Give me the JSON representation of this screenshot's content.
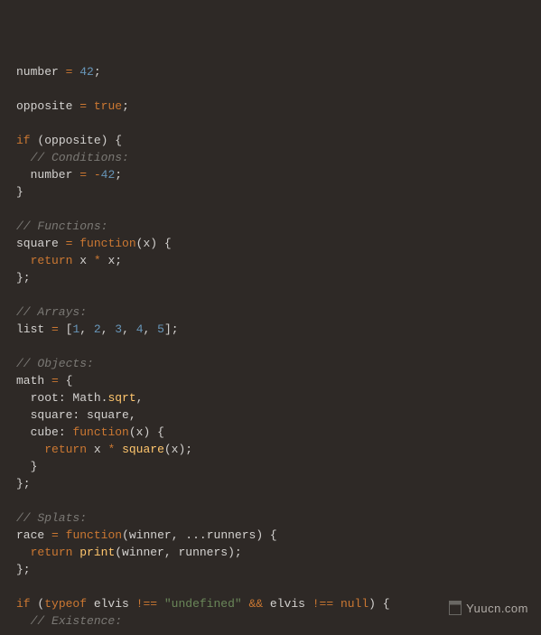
{
  "watermark": "Yuucn.com",
  "code": {
    "lines": [
      [
        {
          "t": "number",
          "c": "id"
        },
        {
          "t": " ",
          "c": "ws"
        },
        {
          "t": "=",
          "c": "op"
        },
        {
          "t": " ",
          "c": "ws"
        },
        {
          "t": "42",
          "c": "num"
        },
        {
          "t": ";",
          "c": "pn"
        }
      ],
      [],
      [
        {
          "t": "opposite",
          "c": "id"
        },
        {
          "t": " ",
          "c": "ws"
        },
        {
          "t": "=",
          "c": "op"
        },
        {
          "t": " ",
          "c": "ws"
        },
        {
          "t": "true",
          "c": "kw"
        },
        {
          "t": ";",
          "c": "pn"
        }
      ],
      [],
      [
        {
          "t": "if",
          "c": "kw"
        },
        {
          "t": " (opposite) {",
          "c": "pn"
        }
      ],
      [
        {
          "t": "  ",
          "c": "ws"
        },
        {
          "t": "// Conditions:",
          "c": "cm"
        }
      ],
      [
        {
          "t": "  number ",
          "c": "id"
        },
        {
          "t": "=",
          "c": "op"
        },
        {
          "t": " ",
          "c": "ws"
        },
        {
          "t": "-",
          "c": "op"
        },
        {
          "t": "42",
          "c": "num"
        },
        {
          "t": ";",
          "c": "pn"
        }
      ],
      [
        {
          "t": "}",
          "c": "pn"
        }
      ],
      [],
      [
        {
          "t": "// Functions:",
          "c": "cm"
        }
      ],
      [
        {
          "t": "square",
          "c": "id"
        },
        {
          "t": " ",
          "c": "ws"
        },
        {
          "t": "=",
          "c": "op"
        },
        {
          "t": " ",
          "c": "ws"
        },
        {
          "t": "function",
          "c": "kw"
        },
        {
          "t": "(",
          "c": "pn"
        },
        {
          "t": "x",
          "c": "id"
        },
        {
          "t": ") {",
          "c": "pn"
        }
      ],
      [
        {
          "t": "  ",
          "c": "ws"
        },
        {
          "t": "return",
          "c": "kw"
        },
        {
          "t": " x ",
          "c": "id"
        },
        {
          "t": "*",
          "c": "op"
        },
        {
          "t": " x;",
          "c": "id"
        }
      ],
      [
        {
          "t": "};",
          "c": "pn"
        }
      ],
      [],
      [
        {
          "t": "// Arrays:",
          "c": "cm"
        }
      ],
      [
        {
          "t": "list",
          "c": "id"
        },
        {
          "t": " ",
          "c": "ws"
        },
        {
          "t": "=",
          "c": "op"
        },
        {
          "t": " [",
          "c": "pn"
        },
        {
          "t": "1",
          "c": "num"
        },
        {
          "t": ", ",
          "c": "pn"
        },
        {
          "t": "2",
          "c": "num"
        },
        {
          "t": ", ",
          "c": "pn"
        },
        {
          "t": "3",
          "c": "num"
        },
        {
          "t": ", ",
          "c": "pn"
        },
        {
          "t": "4",
          "c": "num"
        },
        {
          "t": ", ",
          "c": "pn"
        },
        {
          "t": "5",
          "c": "num"
        },
        {
          "t": "];",
          "c": "pn"
        }
      ],
      [],
      [
        {
          "t": "// Objects:",
          "c": "cm"
        }
      ],
      [
        {
          "t": "math",
          "c": "id"
        },
        {
          "t": " ",
          "c": "ws"
        },
        {
          "t": "=",
          "c": "op"
        },
        {
          "t": " {",
          "c": "pn"
        }
      ],
      [
        {
          "t": "  ",
          "c": "ws"
        },
        {
          "t": "root",
          "c": "id"
        },
        {
          "t": ": Math.",
          "c": "pn"
        },
        {
          "t": "sqrt",
          "c": "fn"
        },
        {
          "t": ",",
          "c": "pn"
        }
      ],
      [
        {
          "t": "  ",
          "c": "ws"
        },
        {
          "t": "square",
          "c": "id"
        },
        {
          "t": ": square,",
          "c": "pn"
        }
      ],
      [
        {
          "t": "  ",
          "c": "ws"
        },
        {
          "t": "cube",
          "c": "id"
        },
        {
          "t": ": ",
          "c": "pn"
        },
        {
          "t": "function",
          "c": "kw"
        },
        {
          "t": "(",
          "c": "pn"
        },
        {
          "t": "x",
          "c": "id"
        },
        {
          "t": ") {",
          "c": "pn"
        }
      ],
      [
        {
          "t": "    ",
          "c": "ws"
        },
        {
          "t": "return",
          "c": "kw"
        },
        {
          "t": " x ",
          "c": "id"
        },
        {
          "t": "*",
          "c": "op"
        },
        {
          "t": " ",
          "c": "ws"
        },
        {
          "t": "square",
          "c": "fn"
        },
        {
          "t": "(x);",
          "c": "pn"
        }
      ],
      [
        {
          "t": "  }",
          "c": "pn"
        }
      ],
      [
        {
          "t": "};",
          "c": "pn"
        }
      ],
      [],
      [
        {
          "t": "// Splats:",
          "c": "cm"
        }
      ],
      [
        {
          "t": "race",
          "c": "id"
        },
        {
          "t": " ",
          "c": "ws"
        },
        {
          "t": "=",
          "c": "op"
        },
        {
          "t": " ",
          "c": "ws"
        },
        {
          "t": "function",
          "c": "kw"
        },
        {
          "t": "(",
          "c": "pn"
        },
        {
          "t": "winner",
          "c": "id"
        },
        {
          "t": ", ...",
          "c": "pn"
        },
        {
          "t": "runners",
          "c": "id"
        },
        {
          "t": ") {",
          "c": "pn"
        }
      ],
      [
        {
          "t": "  ",
          "c": "ws"
        },
        {
          "t": "return",
          "c": "kw"
        },
        {
          "t": " ",
          "c": "ws"
        },
        {
          "t": "print",
          "c": "fn"
        },
        {
          "t": "(winner, runners);",
          "c": "pn"
        }
      ],
      [
        {
          "t": "};",
          "c": "pn"
        }
      ],
      [],
      [
        {
          "t": "if",
          "c": "kw"
        },
        {
          "t": " (",
          "c": "pn"
        },
        {
          "t": "typeof",
          "c": "kw"
        },
        {
          "t": " elvis ",
          "c": "id"
        },
        {
          "t": "!==",
          "c": "op"
        },
        {
          "t": " ",
          "c": "ws"
        },
        {
          "t": "\"undefined\"",
          "c": "str"
        },
        {
          "t": " ",
          "c": "ws"
        },
        {
          "t": "&&",
          "c": "op"
        },
        {
          "t": " elvis ",
          "c": "id"
        },
        {
          "t": "!==",
          "c": "op"
        },
        {
          "t": " ",
          "c": "ws"
        },
        {
          "t": "null",
          "c": "kw"
        },
        {
          "t": ") {",
          "c": "pn"
        }
      ],
      [
        {
          "t": "  ",
          "c": "ws"
        },
        {
          "t": "// Existence:",
          "c": "cm"
        }
      ]
    ]
  }
}
